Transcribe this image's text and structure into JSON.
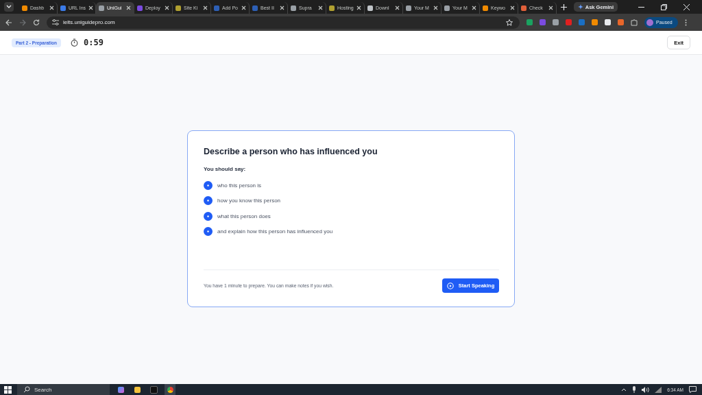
{
  "browser": {
    "tabs": [
      {
        "title": "Dashb",
        "selected": false,
        "color": "#f08a00"
      },
      {
        "title": "URL Ins",
        "selected": false,
        "color": "#3b7be8"
      },
      {
        "title": "UniGui",
        "selected": true,
        "color": "#9aa0a6"
      },
      {
        "title": "Deploy",
        "selected": false,
        "color": "#7b4be0"
      },
      {
        "title": "Site Ki",
        "selected": false,
        "color": "#b0a030"
      },
      {
        "title": "Add Po",
        "selected": false,
        "color": "#2d5fb5"
      },
      {
        "title": "Best II",
        "selected": false,
        "color": "#2d5fb5"
      },
      {
        "title": "Supra",
        "selected": false,
        "color": "#9aa0a6"
      },
      {
        "title": "Hosting",
        "selected": false,
        "color": "#b0a030"
      },
      {
        "title": "Downl",
        "selected": false,
        "color": "#c0c4c8"
      },
      {
        "title": "Your M",
        "selected": false,
        "color": "#9aa0a6"
      },
      {
        "title": "Your M",
        "selected": false,
        "color": "#9aa0a6"
      },
      {
        "title": "Keywo",
        "selected": false,
        "color": "#f08a00"
      },
      {
        "title": "Check",
        "selected": false,
        "color": "#e0603a"
      }
    ],
    "ask_button": "Ask Gemini",
    "url": "ielts.uniguidepro.com",
    "extensions": [
      {
        "color": "#1aa260"
      },
      {
        "color": "#7b4be0"
      },
      {
        "color": "#9aa0a6"
      },
      {
        "color": "#e02020"
      },
      {
        "color": "#1a6fc4"
      },
      {
        "color": "#f08a00"
      },
      {
        "color": "#e8eaed"
      },
      {
        "color": "#e8662a"
      }
    ],
    "profile": "Paused"
  },
  "header": {
    "badge": "Part 2 - Preparation",
    "timer": "0:59",
    "exit": "Exit"
  },
  "card": {
    "title": "Describe a person who has influenced you",
    "subtitle": "You should say:",
    "points": [
      "who this person is",
      "how you know this person",
      "what this person does",
      "and explain how this person has influenced you"
    ],
    "note": "You have 1 minute to prepare. You can make notes if you wish.",
    "button": "Start Speaking"
  },
  "taskbar": {
    "search": "Search",
    "time": "6:34 AM"
  }
}
